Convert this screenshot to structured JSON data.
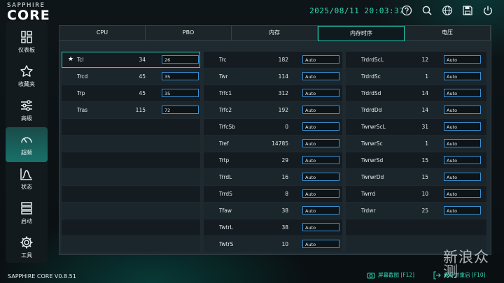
{
  "app": {
    "brand_top": "SAPPHIRE",
    "brand_main": "CORE",
    "version": "SAPPHIRE CORE V0.8.51"
  },
  "header": {
    "datetime": "2025/08/11 20:03:37"
  },
  "sidebar": {
    "items": [
      {
        "label": "仪表板",
        "icon": "dashboard-icon"
      },
      {
        "label": "收藏夹",
        "icon": "star-icon"
      },
      {
        "label": "高级",
        "icon": "sliders-icon"
      },
      {
        "label": "超频",
        "icon": "gauge-icon"
      },
      {
        "label": "状态",
        "icon": "chart-icon"
      },
      {
        "label": "启动",
        "icon": "boot-icon"
      },
      {
        "label": "工具",
        "icon": "gear-icon"
      }
    ],
    "active_index": 3
  },
  "tabs": [
    "CPU",
    "PBO",
    "内存",
    "内存时序",
    "电压"
  ],
  "active_tab": 3,
  "columns": [
    {
      "rows": [
        {
          "label": "Tcl",
          "value": "34",
          "input": "26",
          "starred": true
        },
        {
          "label": "Trcd",
          "value": "45",
          "input": "35"
        },
        {
          "label": "Trp",
          "value": "45",
          "input": "35"
        },
        {
          "label": "Tras",
          "value": "115",
          "input": "72"
        }
      ]
    },
    {
      "rows": [
        {
          "label": "Trc",
          "value": "182",
          "input": "Auto"
        },
        {
          "label": "Twr",
          "value": "114",
          "input": "Auto"
        },
        {
          "label": "Trfc1",
          "value": "312",
          "input": "Auto"
        },
        {
          "label": "Trfc2",
          "value": "192",
          "input": "Auto"
        },
        {
          "label": "TrfcSb",
          "value": "0",
          "input": "Auto"
        },
        {
          "label": "Tref",
          "value": "14785",
          "input": "Auto"
        },
        {
          "label": "Trtp",
          "value": "29",
          "input": "Auto"
        },
        {
          "label": "TrrdL",
          "value": "16",
          "input": "Auto"
        },
        {
          "label": "TrrdS",
          "value": "8",
          "input": "Auto"
        },
        {
          "label": "Tfaw",
          "value": "38",
          "input": "Auto"
        },
        {
          "label": "TwtrL",
          "value": "38",
          "input": "Auto"
        },
        {
          "label": "TwtrS",
          "value": "10",
          "input": "Auto"
        }
      ]
    },
    {
      "rows": [
        {
          "label": "TrdrdScL",
          "value": "12",
          "input": "Auto"
        },
        {
          "label": "TrdrdSc",
          "value": "1",
          "input": "Auto"
        },
        {
          "label": "TrdrdSd",
          "value": "14",
          "input": "Auto"
        },
        {
          "label": "TrdrdDd",
          "value": "14",
          "input": "Auto"
        },
        {
          "label": "TwrwrScL",
          "value": "31",
          "input": "Auto"
        },
        {
          "label": "TwrwrSc",
          "value": "1",
          "input": "Auto"
        },
        {
          "label": "TwrwrSd",
          "value": "15",
          "input": "Auto"
        },
        {
          "label": "TwrwrDd",
          "value": "15",
          "input": "Auto"
        },
        {
          "label": "Twrrd",
          "value": "10",
          "input": "Auto"
        },
        {
          "label": "Trdwr",
          "value": "25",
          "input": "Auto"
        }
      ]
    }
  ],
  "footer": {
    "screenshot_label": "屏幕截图 [F12]",
    "save_restart_label": "保存并重启 [F10]"
  },
  "watermark": "新浪众测",
  "colors": {
    "accent": "#27d4b7",
    "input_border": "#3a8ed0"
  }
}
